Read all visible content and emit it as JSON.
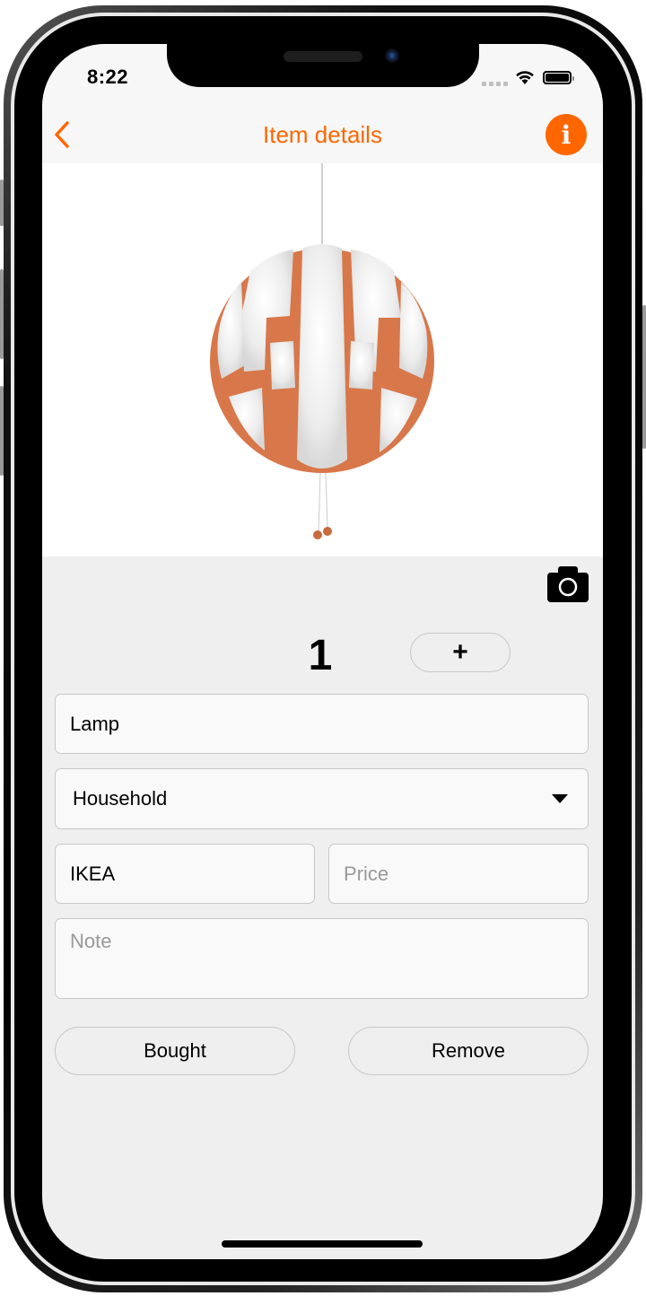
{
  "status_bar": {
    "time": "8:22",
    "signal_icon": "cellular-signal-icon",
    "wifi_icon": "wifi-icon",
    "battery_icon": "battery-icon"
  },
  "navbar": {
    "title": "Item details",
    "back_icon": "chevron-left-icon",
    "info_icon": "info-icon",
    "info_glyph": "i"
  },
  "item": {
    "image_alt": "Pendant lamp photo (white and copper sphere)",
    "quantity": "1",
    "increment_label": "+",
    "camera_icon": "camera-icon"
  },
  "form": {
    "name": {
      "value": "Lamp",
      "placeholder": ""
    },
    "category": {
      "selected": "Household"
    },
    "store": {
      "value": "IKEA",
      "placeholder": ""
    },
    "price": {
      "value": "",
      "placeholder": "Price"
    },
    "note": {
      "value": "",
      "placeholder": "Note"
    }
  },
  "actions": {
    "bought_label": "Bought",
    "remove_label": "Remove"
  },
  "colors": {
    "accent": "#ff6600",
    "background": "#efefef",
    "field_background": "#f9f9f9",
    "field_border": "#c8c8c8"
  }
}
